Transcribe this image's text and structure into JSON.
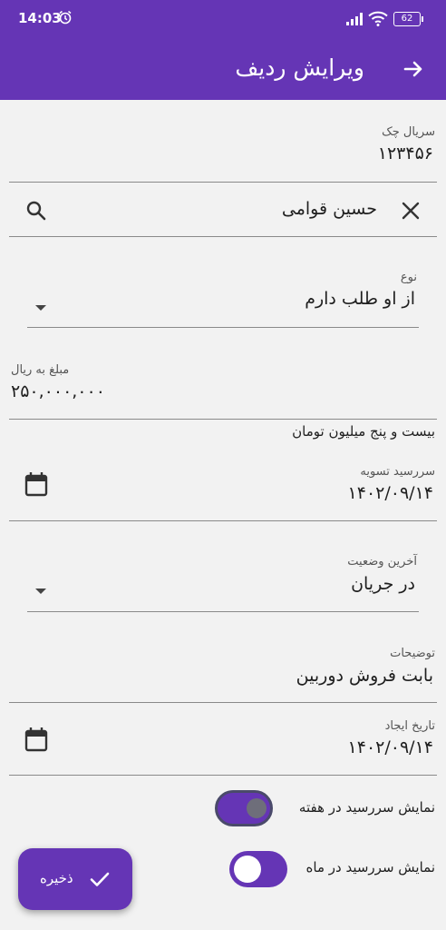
{
  "status_bar": {
    "time": "14:03",
    "battery": "62"
  },
  "app_bar": {
    "title": "ویرایش ردیف"
  },
  "form": {
    "serial": {
      "label": "سریال چک",
      "value": "۱۲۳۴۵۶"
    },
    "person": {
      "value": "حسین قوامی"
    },
    "type": {
      "label": "نوع",
      "value": "از او طلب دارم"
    },
    "amount": {
      "label": "مبلغ به ریال",
      "value": "۲۵۰,۰۰۰,۰۰۰",
      "helper": "بیست و پنج میلیون تومان"
    },
    "due_date": {
      "label": "سررسید تسویه",
      "value": "۱۴۰۲/۰۹/۱۴"
    },
    "status": {
      "label": "آخرین وضعیت",
      "value": "در جریان"
    },
    "notes": {
      "label": "توضیحات",
      "value": "بابت فروش دوربین"
    },
    "created": {
      "label": "تاریخ ایجاد",
      "value": "۱۴۰۲/۰۹/۱۴"
    },
    "show_week": {
      "label": "نمایش سررسید در هفته",
      "checked": true
    },
    "show_month": {
      "label": "نمایش سررسید در ماه",
      "checked": false
    }
  },
  "fab": {
    "label": "ذخیره"
  },
  "colors": {
    "primary": "#6535b5",
    "background": "#f2f2f2"
  },
  "icons": [
    "alarm-icon",
    "signal-icon",
    "wifi-icon",
    "battery-icon",
    "arrow-forward-icon",
    "search-icon",
    "close-icon",
    "dropdown-arrow-icon",
    "calendar-icon",
    "check-icon"
  ]
}
